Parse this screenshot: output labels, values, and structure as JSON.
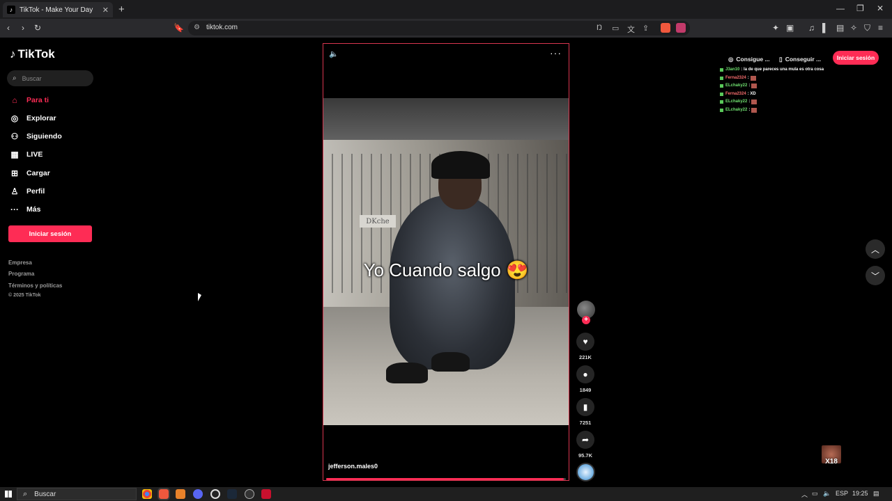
{
  "browser": {
    "tab_title": "TikTok - Make Your Day",
    "tab_close": "✕",
    "new_tab": "+",
    "url": "tiktok.com",
    "window_controls": [
      "—",
      "❐",
      "✕"
    ]
  },
  "sidebar": {
    "logo_text": "TikTok",
    "search_placeholder": "Buscar",
    "nav": [
      {
        "label": "Para ti",
        "icon": "home-icon"
      },
      {
        "label": "Explorar",
        "icon": "compass-icon"
      },
      {
        "label": "Siguiendo",
        "icon": "following-icon"
      },
      {
        "label": "LIVE",
        "icon": "live-icon"
      },
      {
        "label": "Cargar",
        "icon": "upload-icon"
      },
      {
        "label": "Perfil",
        "icon": "profile-icon"
      },
      {
        "label": "Más",
        "icon": "more-icon"
      }
    ],
    "login_label": "Iniciar sesión",
    "footer": [
      "Empresa",
      "Programa",
      "Términos y políticas",
      "© 2025 TikTok"
    ]
  },
  "video": {
    "caption": "Yo Cuando salgo 😍",
    "sign_text": "DKche",
    "author": "jefferson.males0",
    "progress": 0.99
  },
  "actions": {
    "likes": "221K",
    "comments": "1849",
    "saves": "7251",
    "shares": "95.7K"
  },
  "topbar": {
    "get_coins": "Consigue ...",
    "get_app": "Conseguir ...",
    "login": "Iniciar sesión"
  },
  "chat": [
    {
      "user": "J3an10",
      "color": "green",
      "msg": ": la de que pareces una mula es otra cosa"
    },
    {
      "user": "Ferna2324",
      "color": "red",
      "msg": ":",
      "emote": true
    },
    {
      "user": "ELchaky22",
      "color": "green",
      "msg": ":",
      "emote": true
    },
    {
      "user": "Ferna2324",
      "color": "red",
      "msg": ": XD"
    },
    {
      "user": "ELchaky22",
      "color": "green",
      "msg": ":",
      "emote": true
    },
    {
      "user": "ELchaky22",
      "color": "green",
      "msg": ":",
      "emote": true
    }
  ],
  "overlay": {
    "badge": "X18"
  },
  "taskbar": {
    "search_placeholder": "Buscar",
    "language": "ESP",
    "time": "19:25"
  },
  "colors": {
    "accent": "#fe2c55"
  }
}
